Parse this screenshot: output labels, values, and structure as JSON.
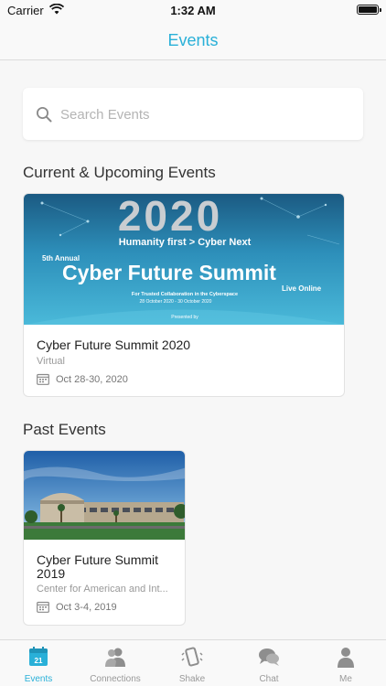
{
  "status_bar": {
    "carrier": "Carrier",
    "time": "1:32 AM"
  },
  "header": {
    "title": "Events"
  },
  "search": {
    "placeholder": "Search Events"
  },
  "sections": {
    "current_title": "Current & Upcoming Events",
    "past_title": "Past Events"
  },
  "current_events": [
    {
      "name": "Cyber Future Summit 2020",
      "venue": "Virtual",
      "date": "Oct 28-30, 2020",
      "banner": {
        "year": "2020",
        "tagline": "Humanity first > Cyber Next",
        "annual": "5th Annual",
        "headline": "Cyber Future Summit",
        "mode": "Live Online",
        "subtitle": "For Trusted Collaboration in the Cyberspace",
        "dates": "28 October 2020 - 30 October 2020",
        "presented": "Presented by"
      }
    }
  ],
  "past_events": [
    {
      "name": "Cyber Future Summit 2019",
      "venue": "Center for American and Int...",
      "date": "Oct 3-4, 2019"
    }
  ],
  "tabs": [
    {
      "label": "Events",
      "icon": "calendar-icon",
      "badge": "21",
      "active": true
    },
    {
      "label": "Connections",
      "icon": "people-icon",
      "active": false
    },
    {
      "label": "Shake",
      "icon": "shake-phone-icon",
      "active": false
    },
    {
      "label": "Chat",
      "icon": "chat-bubbles-icon",
      "active": false
    },
    {
      "label": "Me",
      "icon": "person-icon",
      "active": false
    }
  ],
  "colors": {
    "accent": "#29b0d8",
    "banner_bg": "#3a9ec4",
    "inactive": "#999999"
  }
}
